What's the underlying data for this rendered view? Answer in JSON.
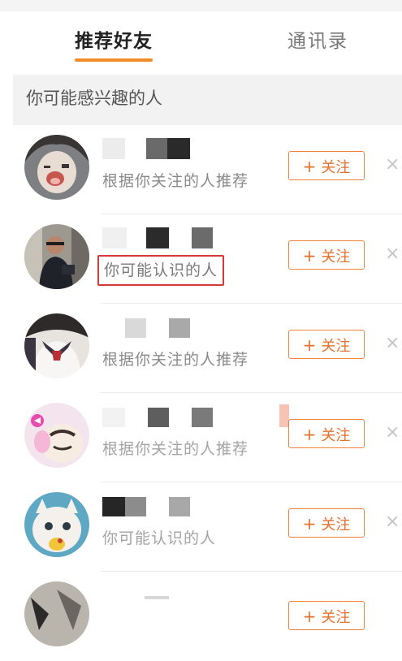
{
  "tabs": {
    "recommend": "推荐好友",
    "contacts": "通讯录"
  },
  "section_title": "你可能感兴趣的人",
  "follow_label": "关注",
  "follow_plus": "+",
  "close_glyph": "×",
  "users": [
    {
      "reason": "根据你关注的人推荐",
      "highlighted": false
    },
    {
      "reason": "你可能认识的人",
      "highlighted": true
    },
    {
      "reason": "根据你关注的人推荐",
      "highlighted": false
    },
    {
      "reason": "根据你关注的人推荐",
      "highlighted": false
    },
    {
      "reason": "你可能认识的人",
      "highlighted": false
    },
    {
      "reason": "",
      "highlighted": false
    }
  ],
  "colors": {
    "accent": "#f28c28",
    "follow_border": "#f0823c",
    "highlight_box": "#d23a3a"
  }
}
